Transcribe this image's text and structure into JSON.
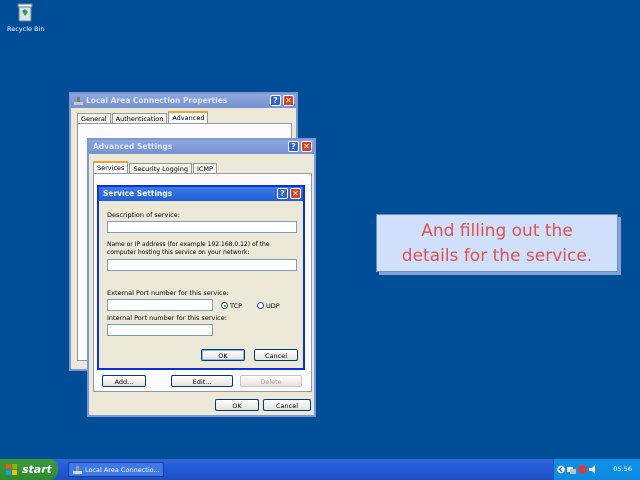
{
  "desktop": {
    "recycle_bin_label": "Recycle Bin"
  },
  "lac_window": {
    "title": "Local Area Connection Properties",
    "tabs": [
      "General",
      "Authentication",
      "Advanced"
    ],
    "active_tab": "Advanced"
  },
  "adv_window": {
    "title": "Advanced Settings",
    "tabs": [
      "Services",
      "Security Logging",
      "ICMP"
    ],
    "active_tab": "Services",
    "buttons": {
      "add": "Add...",
      "edit": "Edit...",
      "delete": "Delete",
      "ok": "OK",
      "cancel": "Cancel"
    }
  },
  "service_dialog": {
    "title": "Service Settings",
    "description_label": "Description of service:",
    "description_value": "",
    "host_label_line1": "Name or IP address (for example 192.168.0.12) of the",
    "host_label_line2": "computer hosting this service on your network:",
    "host_value": "",
    "external_port_label": "External Port number for this service:",
    "external_port_value": "",
    "internal_port_label": "Internal Port number for this service:",
    "internal_port_value": "",
    "protocol_tcp": "TCP",
    "protocol_udp": "UDP",
    "protocol_selected": "TCP",
    "ok": "OK",
    "cancel": "Cancel"
  },
  "callout": {
    "line1": "And filling out the",
    "line2": "details for the service."
  },
  "taskbar": {
    "start_label": "start",
    "task_button": "Local Area Connectio...",
    "clock": "05:56"
  },
  "colors": {
    "desktop": "#004e98",
    "callout_text": "#e2504d",
    "title_active": "#1f5fd6",
    "start_green": "#2e8a2e"
  }
}
